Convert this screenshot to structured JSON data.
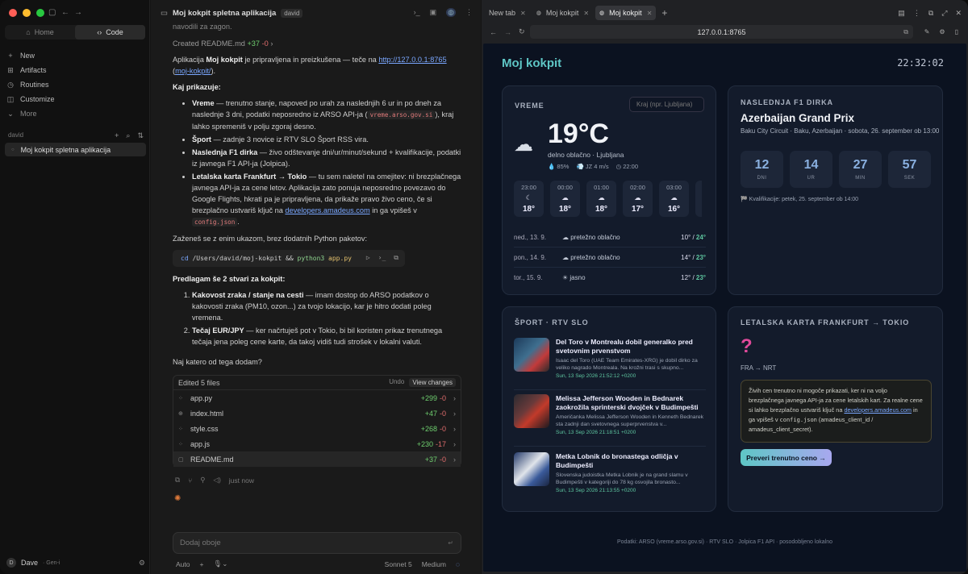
{
  "sidebar": {
    "seg_home": "Home",
    "seg_code": "Code",
    "nav": [
      "New",
      "Artifacts",
      "Routines",
      "Customize",
      "More"
    ],
    "section_label": "david",
    "chat_item": "Moj kokpit spletna aplikacija",
    "user_initial": "D",
    "user_name": "Dave",
    "user_plan": "· Gen-i"
  },
  "chat": {
    "title": "Moj kokpit spletna aplikacija",
    "tag": "david",
    "prev_line": "navodili za zagon.",
    "created": "Created README.md",
    "created_add": "+37",
    "created_rm": "-0",
    "intro_1": "Aplikacija ",
    "intro_bold": "Moj kokpit",
    "intro_2": " je pripravljena in preizkušena — teče na ",
    "intro_link": "http://127.0.0.1:8765",
    "intro_3": " (",
    "intro_link2": "moj-kokpit/",
    "intro_4": ").",
    "shows_head": "Kaj prikazuje:",
    "b1_h": "Vreme",
    "b1_t1": " — trenutno stanje, napoved po urah za naslednjih 6 ur in po dneh za naslednje 3 dni, podatki neposredno iz ARSO API-ja (",
    "b1_code": "vreme.arso.gov.si",
    "b1_t2": "), kraj lahko spremeniš v polju zgoraj desno.",
    "b2_h": "Šport",
    "b2_t": " — zadnje 3 novice iz RTV SLO Šport RSS vira.",
    "b3_h": "Naslednja F1 dirka",
    "b3_t": " — živo odštevanje dni/ur/minut/sekund + kvalifikacije, podatki iz javnega F1 API-ja (Jolpica).",
    "b4_h": "Letalska karta Frankfurt → Tokio",
    "b4_t1": " — tu sem naletel na omejitev: ni brezplačnega javnega API-ja za cene letov. Aplikacija zato ponuja neposredno povezavo do Google Flights, hkrati pa je pripravljena, da prikaže pravo živo ceno, če si brezplačno ustvariš ključ na ",
    "b4_link": "developers.amadeus.com",
    "b4_t2": " in ga vpišeš v ",
    "b4_code": "config.json",
    "b4_t3": ".",
    "run_line": "Zaženeš se z enim ukazom, brez dodatnih Python paketov:",
    "cmd_cd": "cd",
    "cmd_path": " /Users/david/moj-kokpit ",
    "cmd_and": "&& ",
    "cmd_py": "python3",
    "cmd_file": " app.py",
    "propose_head": "Predlagam še 2 stvari za kokpit:",
    "o1_h": "Kakovost zraka / stanje na cesti",
    "o1_t": " — imam dostop do ARSO podatkov o kakovosti zraka (PM10, ozon...) za tvojo lokacijo, kar je hitro dodati poleg vremena.",
    "o2_h": "Tečaj EUR/JPY",
    "o2_t": " — ker načrtuješ pot v Tokio, bi bil koristen prikaz trenutnega tečaja jena poleg cene karte, da takoj vidiš tudi strošek v lokalni valuti.",
    "question": "Naj katero od tega dodam?",
    "files_head": "Edited 5 files",
    "undo": "Undo",
    "view_changes": "View changes",
    "files": [
      {
        "name": "app.py",
        "add": "+299",
        "rm": "-0"
      },
      {
        "name": "index.html",
        "add": "+47",
        "rm": "-0"
      },
      {
        "name": "style.css",
        "add": "+268",
        "rm": "-0"
      },
      {
        "name": "app.js",
        "add": "+230",
        "rm": "-17"
      },
      {
        "name": "README.md",
        "add": "+37",
        "rm": "-0"
      }
    ],
    "just_now": "just now",
    "input_placeholder": "Dodaj oboje",
    "mode": "Auto",
    "model": "Sonnet 5",
    "effort": "Medium"
  },
  "browser": {
    "tabs": [
      "New tab",
      "Moj kokpit",
      "Moj kokpit"
    ],
    "url": "127.0.0.1:8765"
  },
  "dashboard": {
    "title": "Moj kokpit",
    "clock": "22:32:02",
    "weather": {
      "title": "VREME",
      "city_placeholder": "Kraj (npr. Ljubljana)",
      "temp": "19°C",
      "cond": "delno oblačno · Ljubljana",
      "humidity": "💧 85%",
      "wind": "💨 JZ 4 m/s",
      "time": "◷ 22:00",
      "hours": [
        {
          "h": "23:00",
          "i": "☾",
          "t": "18°"
        },
        {
          "h": "00:00",
          "i": "☁",
          "t": "18°"
        },
        {
          "h": "01:00",
          "i": "☁",
          "t": "18°"
        },
        {
          "h": "02:00",
          "i": "☁",
          "t": "17°"
        },
        {
          "h": "03:00",
          "i": "☁",
          "t": "16°"
        }
      ],
      "days": [
        {
          "d": "ned., 13. 9.",
          "c": "☁ pretežno oblačno",
          "lo": "10° / ",
          "hi": "24°"
        },
        {
          "d": "pon., 14. 9.",
          "c": "☁ pretežno oblačno",
          "lo": "14° / ",
          "hi": "23°"
        },
        {
          "d": "tor., 15. 9.",
          "c": "☀ jasno",
          "lo": "12° / ",
          "hi": "23°"
        }
      ]
    },
    "f1": {
      "title": "NASLEDNJA F1 DIRKA",
      "name": "Azerbaijan Grand Prix",
      "sub": "Baku City Circuit · Baku, Azerbaijan · sobota, 26. september ob 13:00",
      "countdown": [
        {
          "v": "12",
          "l": "DNI"
        },
        {
          "v": "14",
          "l": "UR"
        },
        {
          "v": "27",
          "l": "MIN"
        },
        {
          "v": "57",
          "l": "SEK"
        }
      ],
      "qual": "🏁 Kvalifikacije: petek, 25. september ob 14:00"
    },
    "sport": {
      "title": "ŠPORT · RTV SLO",
      "news": [
        {
          "t": "Del Toro v Montrealu dobil generalko pred svetovnim prvenstvom",
          "d": "Isaac del Toro (UAE Team Emirates-XRG) je dobil dirko za veliko nagrado Montreala. Na krožni trasi s skupno...",
          "dt": "Sun, 13 Sep 2026 21:52:12 +0200"
        },
        {
          "t": "Melissa Jefferson Wooden in Bednarek zaokrožila sprinterski dvojček v Budimpešti",
          "d": "Američanka Melissa Jefferson Wooden in Kenneth Bednarek sta zadnji dan svetovnega superprvenstva v...",
          "dt": "Sun, 13 Sep 2026 21:18:51 +0200"
        },
        {
          "t": "Metka Lobnik do bronastega odličja v Budimpešti",
          "d": "Slovenska judoistka Metka Lobnik je na grand slamu v Budimpešti v kategoriji do 78 kg osvojila bronasto...",
          "dt": "Sun, 13 Sep 2026 21:13:55 +0200"
        }
      ]
    },
    "flight": {
      "title": "LETALSKA KARTA FRANKFURT → TOKIO",
      "q": "?",
      "route": "FRA → NRT",
      "n1": "Živih cen trenutno ni mogoče prikazati, ker ni na voljo brezplačnega javnega API-ja za cene letalskih kart. Za realne cene si lahko brezplačno ustvariš ključ na ",
      "n_link": "developers.amadeus.com",
      "n2": " in ga vpišeš v ",
      "n_code": "config.json",
      "n3": " (amadeus_client_id / amadeus_client_secret).",
      "button": "Preveri trenutno ceno →"
    },
    "footer": "Podatki: ARSO (vreme.arso.gov.si) · RTV SLO · Jolpica F1 API · posodobljeno lokalno"
  }
}
